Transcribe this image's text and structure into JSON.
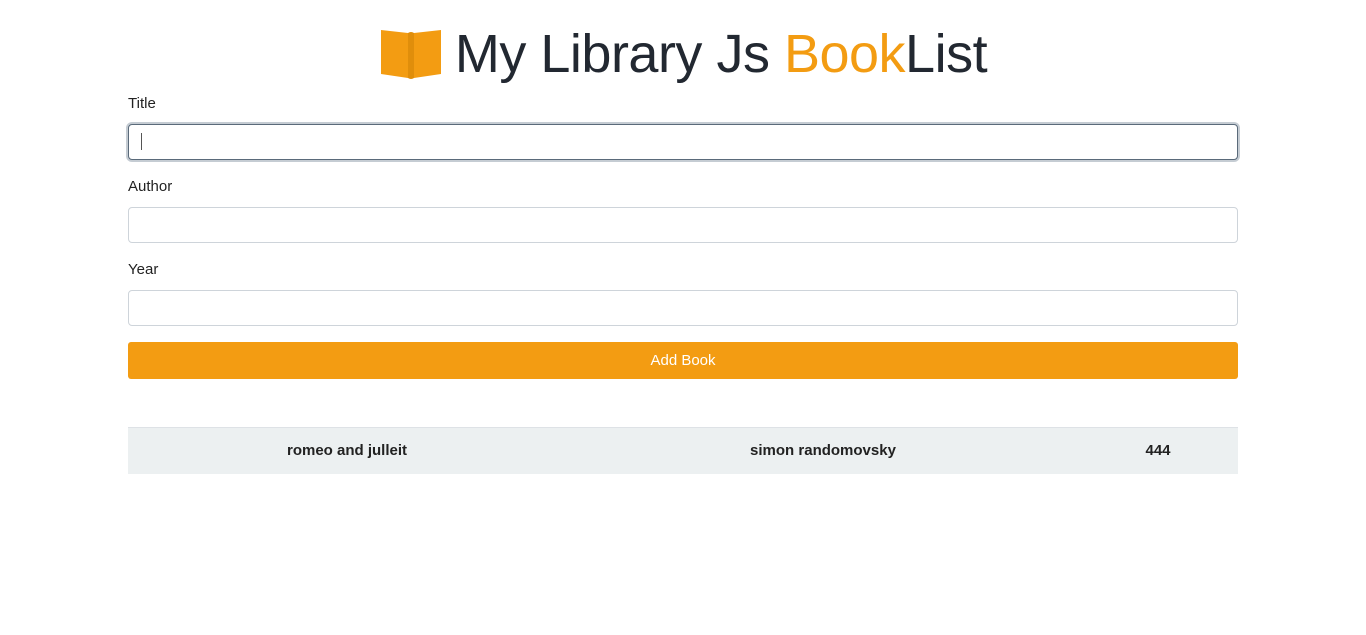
{
  "header": {
    "title_part1": "My Library Js ",
    "title_accent": "Book",
    "title_part2": "List",
    "logo_icon": "open-book-icon"
  },
  "form": {
    "title_label": "Title",
    "title_value": "",
    "author_label": "Author",
    "author_value": "",
    "year_label": "Year",
    "year_value": "",
    "submit_label": "Add Book"
  },
  "books": [
    {
      "title": "romeo and julleit",
      "author": "simon randomovsky",
      "year": "444"
    }
  ],
  "colors": {
    "accent": "#f39c12",
    "table_row_bg": "#ecf0f1",
    "title_text": "#222831"
  }
}
